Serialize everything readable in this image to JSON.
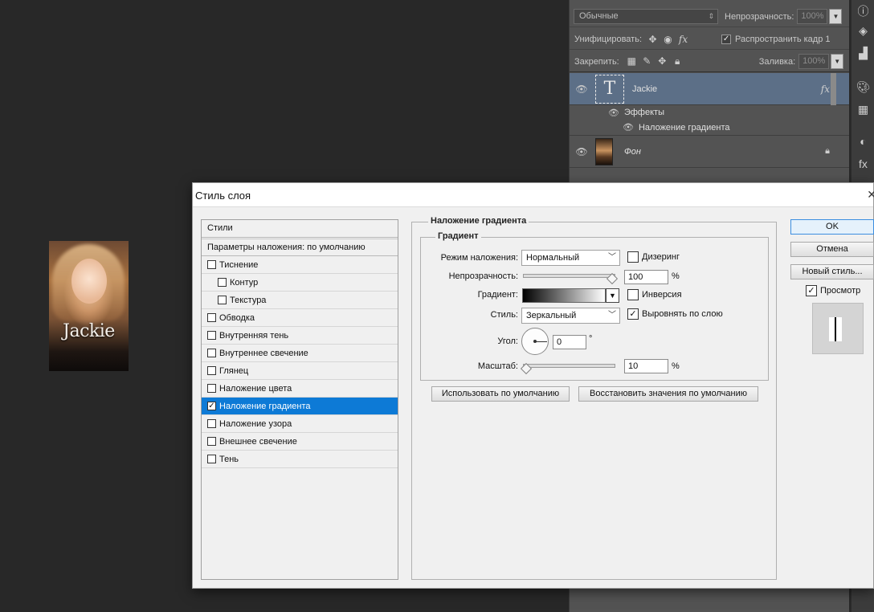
{
  "canvas": {
    "text": "Jackie"
  },
  "layers_panel": {
    "blend_mode": "Обычные",
    "opacity_label": "Непрозрачность:",
    "opacity_value": "100%",
    "unify_label": "Унифицировать:",
    "propagate_label": "Распространить кадр 1",
    "lock_label": "Закрепить:",
    "fill_label": "Заливка:",
    "fill_value": "100%",
    "layers": [
      {
        "name": "Jackie",
        "type": "text"
      },
      {
        "name": "Эффекты"
      },
      {
        "name": "Наложение градиента"
      },
      {
        "name": "Фон",
        "type": "image"
      }
    ]
  },
  "dialog": {
    "title": "Стиль слоя",
    "styles_header": "Стили",
    "blend_options": "Параметры наложения: по умолчанию",
    "styles": [
      {
        "label": "Тиснение",
        "checked": false,
        "sub": false
      },
      {
        "label": "Контур",
        "checked": false,
        "sub": true
      },
      {
        "label": "Текстура",
        "checked": false,
        "sub": true
      },
      {
        "label": "Обводка",
        "checked": false,
        "sub": false
      },
      {
        "label": "Внутренняя тень",
        "checked": false,
        "sub": false
      },
      {
        "label": "Внутреннее свечение",
        "checked": false,
        "sub": false
      },
      {
        "label": "Глянец",
        "checked": false,
        "sub": false
      },
      {
        "label": "Наложение цвета",
        "checked": false,
        "sub": false
      },
      {
        "label": "Наложение градиента",
        "checked": true,
        "sub": false,
        "selected": true
      },
      {
        "label": "Наложение узора",
        "checked": false,
        "sub": false
      },
      {
        "label": "Внешнее свечение",
        "checked": false,
        "sub": false
      },
      {
        "label": "Тень",
        "checked": false,
        "sub": false
      }
    ],
    "section_title": "Наложение градиента",
    "group_title": "Градиент",
    "blend_mode_label": "Режим наложения:",
    "blend_mode_value": "Нормальный",
    "dither_label": "Дизеринг",
    "opacity_label": "Непрозрачность:",
    "opacity_value": "100",
    "opacity_unit": "%",
    "gradient_label": "Градиент:",
    "reverse_label": "Инверсия",
    "style_label": "Стиль:",
    "style_value": "Зеркальный",
    "align_label": "Выровнять по слою",
    "angle_label": "Угол:",
    "angle_value": "0",
    "angle_unit": "°",
    "scale_label": "Масштаб:",
    "scale_value": "10",
    "scale_unit": "%",
    "use_default_button": "Использовать по умолчанию",
    "restore_default_button": "Восстановить значения по умолчанию",
    "ok_button": "OK",
    "cancel_button": "Отмена",
    "new_style_button": "Новый стиль...",
    "preview_label": "Просмотр"
  }
}
